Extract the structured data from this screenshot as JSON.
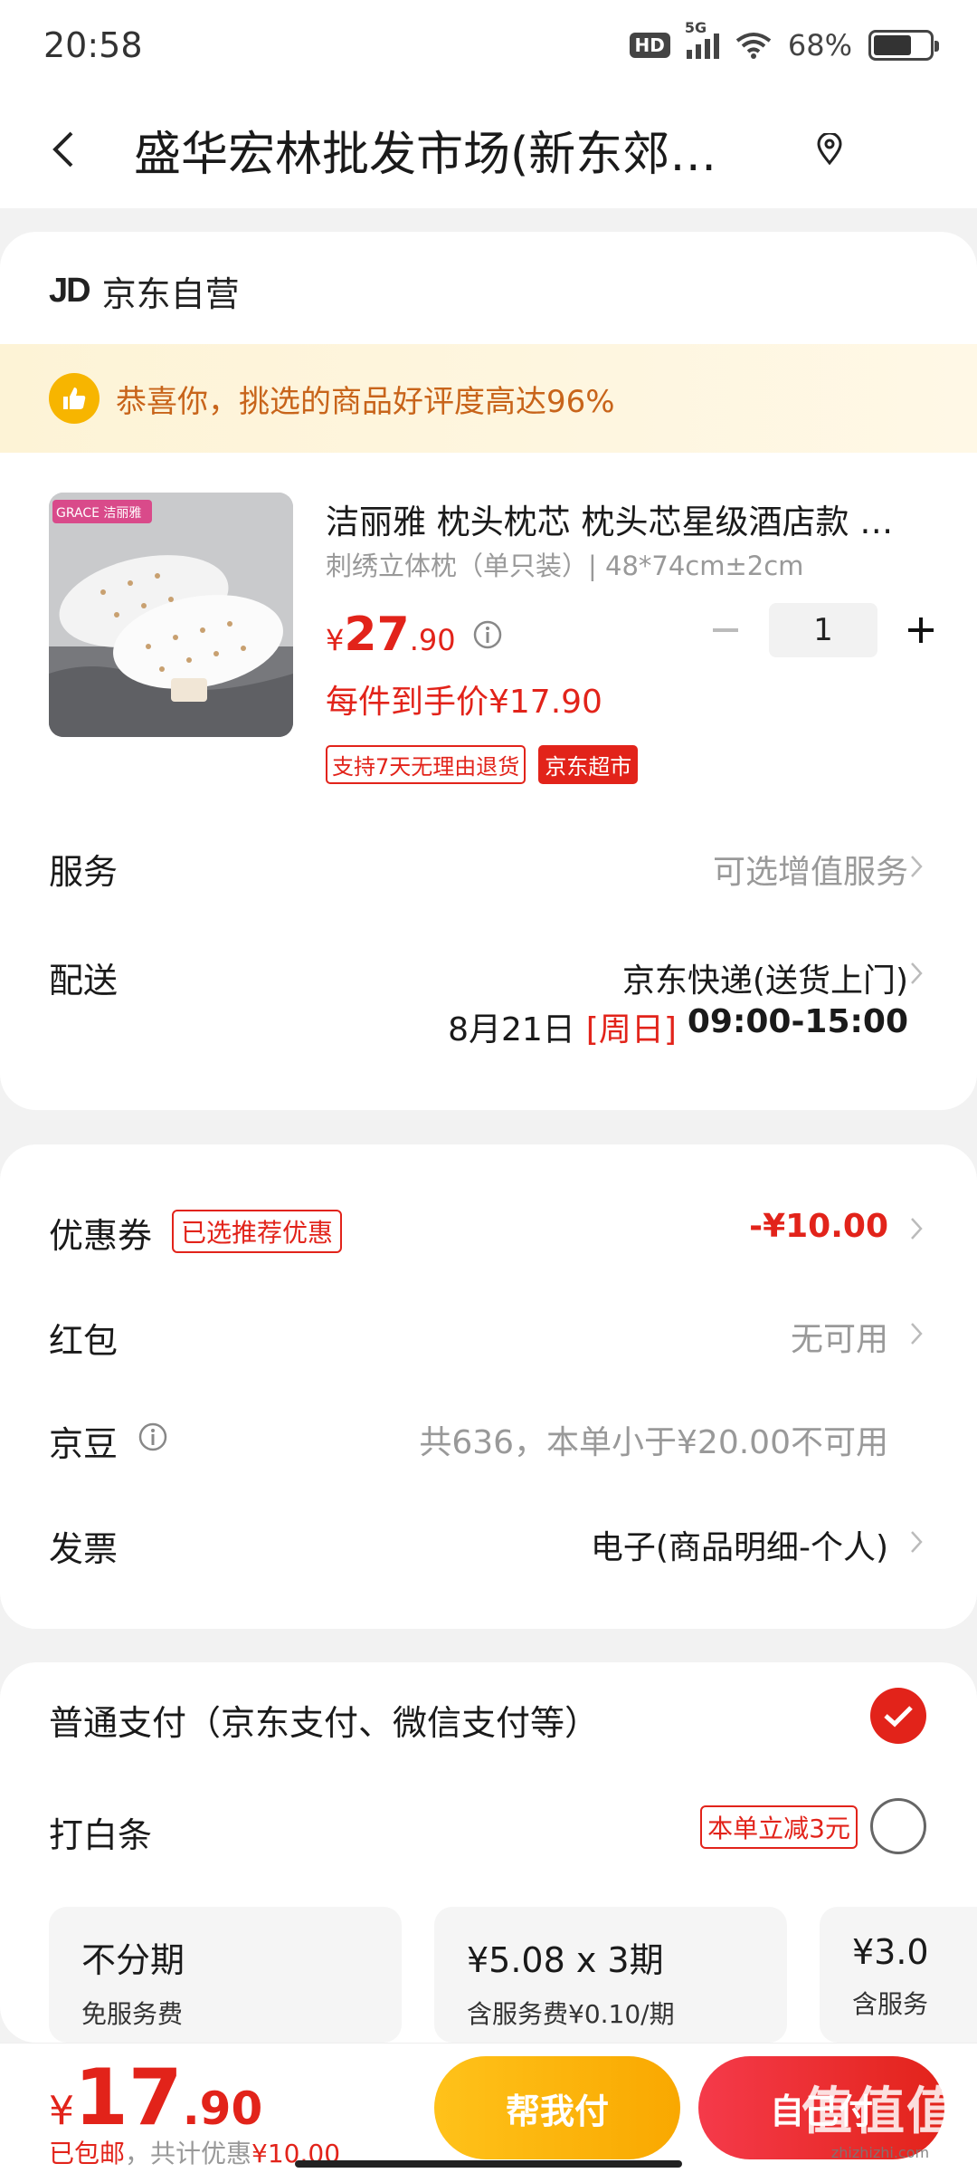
{
  "status": {
    "time": "20:58",
    "hd": "HD",
    "network": "5G",
    "battery": "68%"
  },
  "header": {
    "title": "盛华宏林批发市场(新东郊…"
  },
  "store": {
    "logo": "JD",
    "name": "京东自营"
  },
  "banner": {
    "text": "恭喜你，挑选的商品好评度高达96%"
  },
  "product": {
    "brand_label": "GRACE 洁丽雅",
    "title": "洁丽雅 枕头枕芯 枕头芯星级酒店款 …",
    "spec": "刺绣立体枕（单只装）| 48*74cm±2cm",
    "price_symbol": "¥",
    "price_int": "27",
    "price_dec": ".90",
    "quantity": "1",
    "hand_price": "每件到手价¥17.90",
    "tag_return": "支持7天无理由退货",
    "tag_market": "京东超市"
  },
  "service": {
    "label": "服务",
    "value": "可选增值服务"
  },
  "delivery": {
    "label": "配送",
    "method": "京东快递(送货上门)",
    "date": "8月21日",
    "weekday": "[周日]",
    "time": "09:00-15:00"
  },
  "coupon": {
    "label": "优惠券",
    "badge": "已选推荐优惠",
    "value": "-¥10.00"
  },
  "redpacket": {
    "label": "红包",
    "value": "无可用"
  },
  "jingdou": {
    "label": "京豆",
    "value": "共636，本单小于¥20.00不可用"
  },
  "invoice": {
    "label": "发票",
    "value": "电子(商品明细-个人)"
  },
  "payment": {
    "normal_label": "普通支付（京东支付、微信支付等）",
    "baitiao_label": "打白条",
    "baitiao_promo": "本单立减3元",
    "plans": [
      {
        "title": "不分期",
        "sub": "免服务费"
      },
      {
        "title": "¥5.08 x 3期",
        "sub": "含服务费¥0.10/期"
      },
      {
        "title": "¥3.0",
        "sub": "含服务"
      }
    ]
  },
  "bottom": {
    "total_symbol": "¥",
    "total_int": "17",
    "total_dec": ".90",
    "shipping": "已包邮",
    "discount_prefix": "，共计优惠",
    "discount": "¥10.00",
    "help_pay": "帮我付",
    "self_pay": "自己付",
    "watermark": "值值值",
    "watermark_sub": "zhizhizhi.com"
  }
}
